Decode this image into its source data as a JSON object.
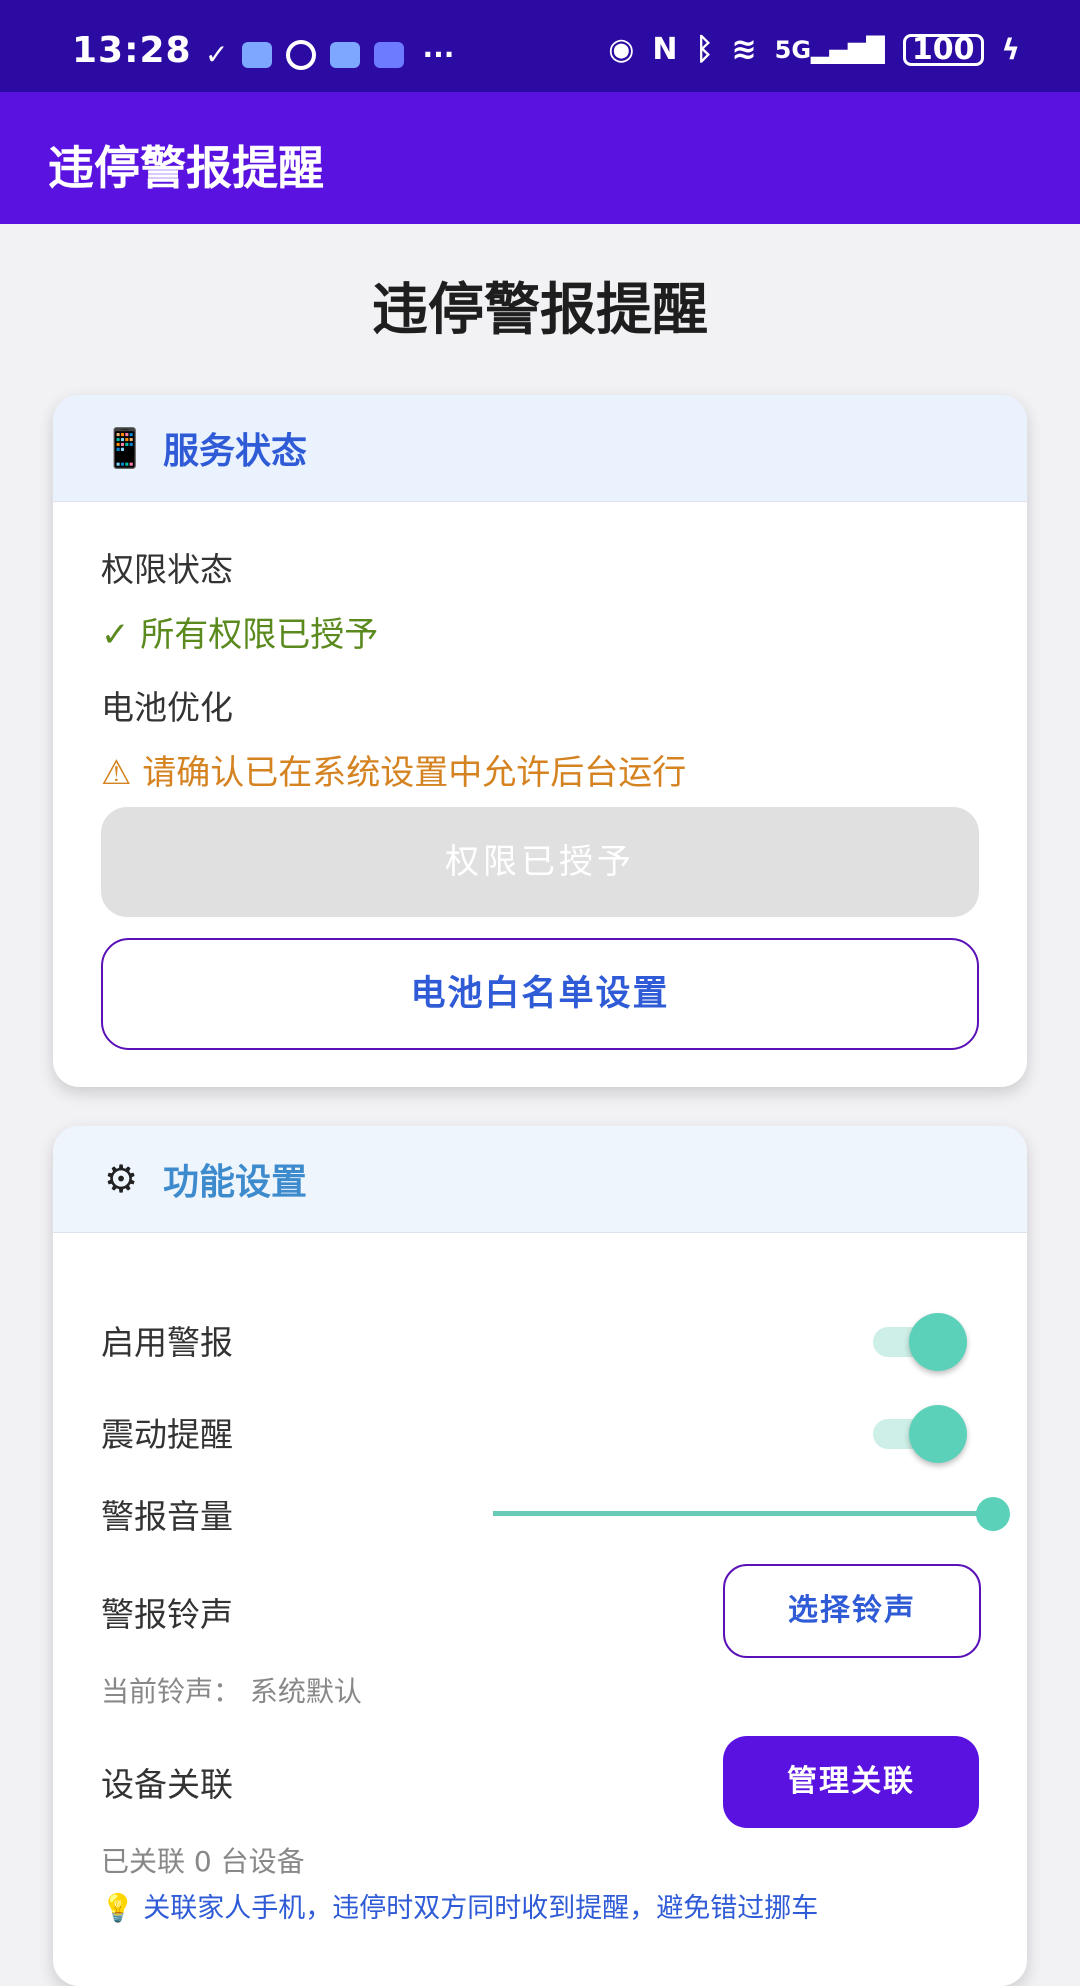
{
  "status_bar": {
    "time": "13:28",
    "notification_icons": [
      "check-icon",
      "message-icon",
      "circle-icon",
      "chat-icon",
      "app-icon"
    ],
    "overflow": "···",
    "right_icons": [
      "eye-icon",
      "nfc-icon",
      "bluetooth-icon",
      "wifi-icon",
      "signal-5g-icon"
    ],
    "battery": "100"
  },
  "app_bar": {
    "title": "违停警报提醒"
  },
  "page": {
    "heading": "违停警报提醒"
  },
  "service_card": {
    "icon": "phone-icon",
    "title": "服务状态",
    "permission_label": "权限状态",
    "permission_status": "✓ 所有权限已授予",
    "battery_label": "电池优化",
    "battery_warning": "⚠ 请确认已在系统设置中允许后台运行",
    "grant_button": "权限已授予",
    "whitelist_button": "电池白名单设置"
  },
  "feature_card": {
    "icon": "gear-icon",
    "title": "功能设置",
    "enable_alarm_label": "启用警报",
    "enable_alarm_on": true,
    "vibrate_label": "震动提醒",
    "vibrate_on": true,
    "volume_label": "警报音量",
    "volume_level": 1.0,
    "ringtone_label": "警报铃声",
    "choose_ringtone_button": "选择铃声",
    "current_ringtone": "当前铃声： 系统默认",
    "device_link_label": "设备关联",
    "manage_link_button": "管理关联",
    "linked_count": "已关联 0 台设备",
    "tip": "💡 关联家人手机，违停时双方同时收到提醒，避免错过挪车"
  },
  "colors": {
    "status_bar": "#2C0BA3",
    "app_bar": "#5A12E0",
    "accent_teal": "#5CD1BA",
    "link_blue": "#2F5BD6",
    "success_green": "#5A8A1E",
    "warning_orange": "#D58221"
  }
}
